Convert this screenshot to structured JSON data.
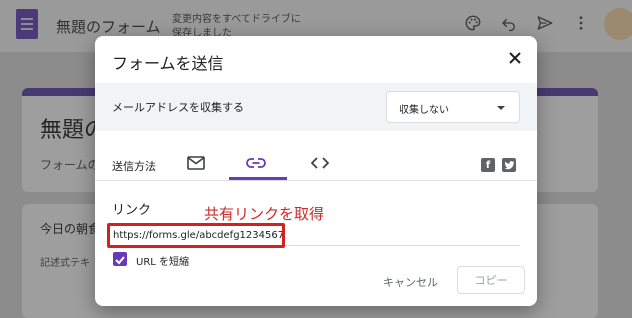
{
  "app": {
    "title": "無題のフォーム",
    "status_line1": "変更内容をすべてドライブに",
    "status_line2": "保存しました",
    "icons": [
      "palette-icon",
      "undo-icon",
      "send-icon",
      "more-vert-icon"
    ]
  },
  "background": {
    "form_title": "無題の",
    "form_description": "フォームの",
    "question_title": "今日の朝食",
    "question_placeholder": "記述式テキ"
  },
  "dialog": {
    "title": "フォームを送信",
    "email_label": "メールアドレスを収集する",
    "email_select_value": "収集しない",
    "send_via_label": "送信方法",
    "tabs": [
      {
        "name": "email",
        "icon": "mail-icon",
        "active": false
      },
      {
        "name": "link",
        "icon": "link-icon",
        "active": true
      },
      {
        "name": "embed",
        "icon": "code-icon",
        "active": false
      }
    ],
    "social": {
      "facebook": "f",
      "twitter": "t"
    },
    "link_label": "リンク",
    "annotation": "共有リンクを取得",
    "url": "https://forms.gle/abcdefg1234567",
    "shorten_label": "URL を短縮",
    "shorten_checked": true,
    "cancel_label": "キャンセル",
    "copy_label": "コピー",
    "accent_color": "#673ab7",
    "highlight_color": "#d32020"
  }
}
